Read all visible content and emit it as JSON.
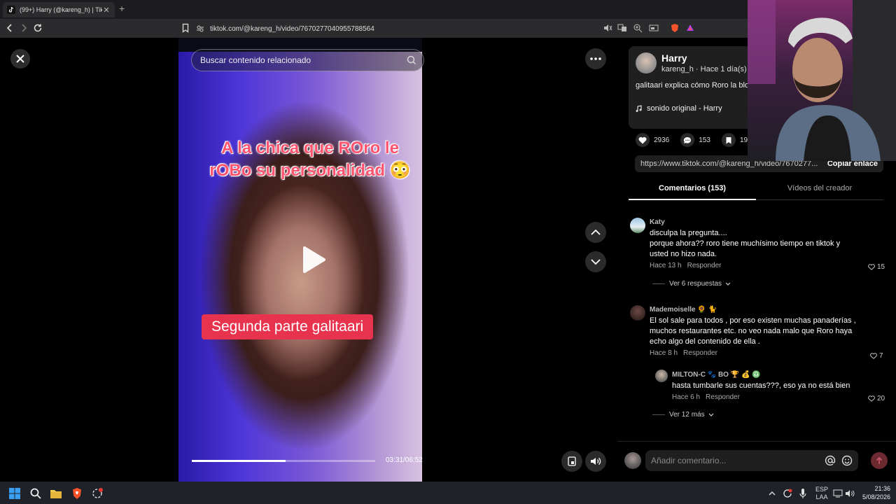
{
  "browser": {
    "tab_title": "(99+) Harry (@kareng_h) | TikTok",
    "url": "tiktok.com/@kareng_h/video/7670277040955788564"
  },
  "video": {
    "search_placeholder": "Buscar contenido relacionado",
    "caption_top": "A la chica que ROro le rOBo su personalidad 😳",
    "caption_bottom": "Segunda parte galitaari",
    "time": "03:31/06:52",
    "progress": 0.512
  },
  "post": {
    "author_name": "Harry",
    "author_sub": "kareng_h · Hace 1 día(s)",
    "description": "galitaari explica cómo Roro la bloq... viera cómo le estaba robando su c...",
    "sound": "sonido original - Harry",
    "likes": "2936",
    "comments_count": "153",
    "saves": "194",
    "link": "https://www.tiktok.com/@kareng_h/video/7670277...",
    "copy_label": "Copiar enlace"
  },
  "tabs": {
    "comments": "Comentarios (153)",
    "creator_videos": "Vídeos del creador"
  },
  "comments": [
    {
      "user": "Katy",
      "text": "disculpa la pregunta....\nporque ahora?? roro tiene muchísimo tiempo en tiktok y usted no hizo nada.",
      "time": "Hace 13 h",
      "reply": "Responder",
      "likes": "15",
      "more": "Ver 6 respuestas"
    },
    {
      "user": "Mademoiselle 🌻 🐈",
      "text": "El sol sale para todos , por eso existen muchas panaderías , muchos restaurantes etc. no veo nada malo que Roro haya echo algo del contenido de ella .",
      "time": "Hace 8 h",
      "reply": "Responder",
      "likes": "7"
    },
    {
      "user": "MILTON-C 🐾 BO 🏆 💰 ♎",
      "text": "hasta tumbarle sus cuentas???, eso ya no está bien",
      "time": "Hace 6 h",
      "reply": "Responder",
      "likes": "20",
      "more": "Ver 12 más"
    }
  ],
  "composer": {
    "placeholder": "Añadir comentario..."
  },
  "taskbar": {
    "lang_top": "ESP",
    "lang_bottom": "LAA",
    "time": "21:36",
    "date": "5/08/2026"
  }
}
